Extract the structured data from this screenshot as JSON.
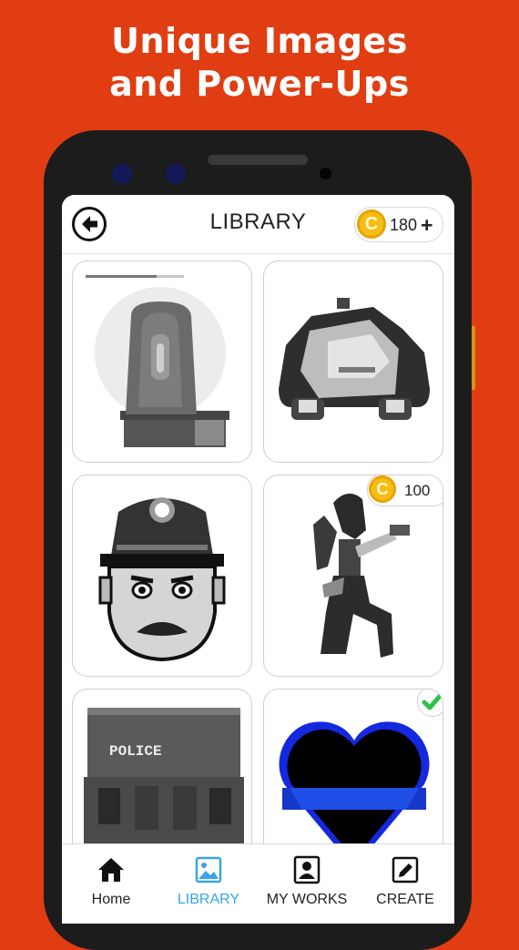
{
  "promo": {
    "line1": "Unique Images",
    "line2": "and Power-Ups"
  },
  "colors": {
    "background": "#e03d12",
    "accent_active": "#3aa4e6",
    "coin": "#f6bd14",
    "check": "#2ec24a"
  },
  "app_bar": {
    "back_icon": "arrow-left-circle-icon",
    "title": "LIBRARY",
    "coin_symbol": "C",
    "coin_balance": "180",
    "add_symbol": "+"
  },
  "library": {
    "items": [
      {
        "subject": "siren",
        "progress_fraction": 0.72
      },
      {
        "subject": "police car"
      },
      {
        "subject": "police officer"
      },
      {
        "subject": "woman with gun",
        "price": "100",
        "coin_symbol": "C"
      },
      {
        "subject": "police van",
        "vehicle_text": "POLICE"
      },
      {
        "subject": "blue line heart",
        "completed": true
      }
    ]
  },
  "nav": {
    "items": [
      {
        "label": "Home",
        "icon": "home-icon",
        "active": false
      },
      {
        "label": "LIBRARY",
        "icon": "image-icon",
        "active": true
      },
      {
        "label": "MY WORKS",
        "icon": "portrait-icon",
        "active": false
      },
      {
        "label": "CREATE",
        "icon": "edit-pencil-icon",
        "active": false
      }
    ]
  }
}
